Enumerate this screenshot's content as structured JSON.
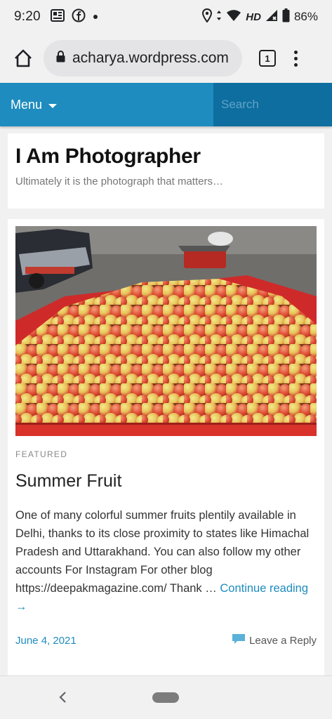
{
  "status_bar": {
    "time": "9:20",
    "network": "HD",
    "battery": "86%"
  },
  "browser": {
    "url": "acharya.wordpress.com",
    "tab_count": "1"
  },
  "nav": {
    "menu_label": "Menu",
    "search_placeholder": "Search"
  },
  "site": {
    "title": "I Am Photographer",
    "description": "Ultimately it is the photograph that matters…"
  },
  "post": {
    "category": "FEATURED",
    "title": "Summer Fruit",
    "excerpt": "One of many colorful summer fruits plentily available in Delhi, thanks to its close proximity to states like Himachal Pradesh and Uttarakhand. You can also follow my other accounts For Instagram For other blog https://deepakmagazine.com/ Thank … ",
    "continue_label": "Continue reading →",
    "date": "June 4, 2021",
    "reply_label": "Leave a Reply"
  },
  "colors": {
    "accent": "#1e8cbe",
    "nav_dark": "#0f6ea0"
  }
}
